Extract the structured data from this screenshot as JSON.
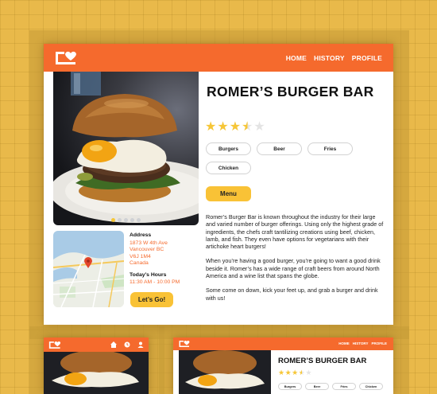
{
  "nav": {
    "links": [
      "HOME",
      "HISTORY",
      "PROFILE"
    ]
  },
  "restaurant": {
    "name": "ROMER’S BURGER BAR",
    "rating": 3.5,
    "rating_max": 5,
    "tags": [
      "Burgers",
      "Beer",
      "Fries",
      "Chicken"
    ],
    "menu_label": "Menu",
    "description": [
      "Romer’s Burger Bar is known throughout the industry for their large and varied number of burger offerings. Using only the highest grade of ingredients, the chefs craft tantilizing creations using beef, chicken, lamb, and fish. They even have options for vegetarians with their artichoke heart burgers!",
      "When you’re having a good burger, you’re going to want a good drink beside it. Romer’s has a wide range of craft beers from around North America and a wine list that spans the globe.",
      "Some come on down, kick your feet up, and grab a burger and drink with us!"
    ],
    "address_label": "Address",
    "address_lines": [
      "1873 W 4th Ave",
      "Vancouver BC",
      "V6J 1M4",
      "Canada"
    ],
    "hours_label": "Today’s Hours",
    "hours": "11:30 AM - 10:00 PM",
    "cta_label": "Let’s Go!",
    "carousel_count": 5,
    "carousel_active": 0
  },
  "tablet_preview": {
    "nav_links": [
      "HOME",
      "HISTORY",
      "PROFILE"
    ],
    "name": "ROMER’S BURGER BAR",
    "tags": [
      "Burgers",
      "Beer",
      "Fries",
      "Chicken"
    ]
  },
  "colors": {
    "accent": "#f56a2d",
    "button": "#f9c236",
    "star": "#f6c637",
    "background": "#e9b94a"
  }
}
